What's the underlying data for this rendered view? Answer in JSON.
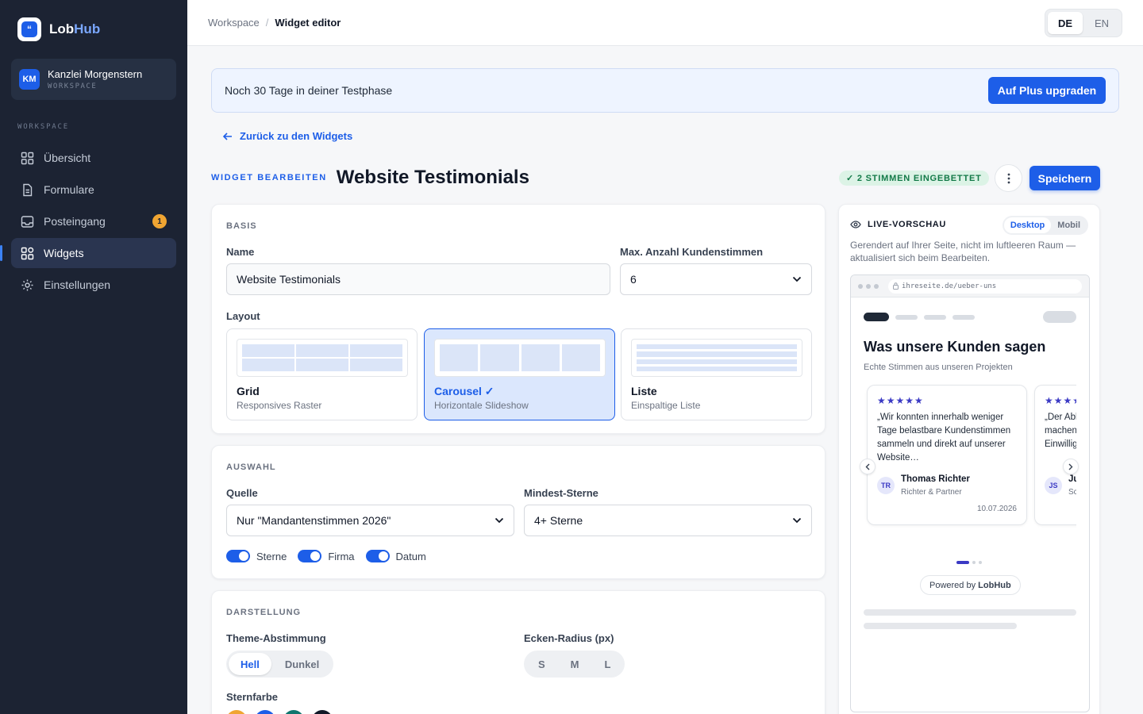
{
  "brand": {
    "name_a": "Lob",
    "name_b": "Hub",
    "logo_glyph": "“"
  },
  "workspace": {
    "initials": "KM",
    "name": "Kanzlei Morgenstern",
    "label": "WORKSPACE"
  },
  "sidebar": {
    "heading": "WORKSPACE",
    "items": [
      {
        "label": "Übersicht",
        "icon": "grid-icon"
      },
      {
        "label": "Formulare",
        "icon": "document-icon"
      },
      {
        "label": "Posteingang",
        "icon": "inbox-icon",
        "badge": "1"
      },
      {
        "label": "Widgets",
        "icon": "widgets-icon",
        "active": true
      },
      {
        "label": "Einstellungen",
        "icon": "gear-icon"
      }
    ]
  },
  "breadcrumb": {
    "root": "Workspace",
    "sep": "/",
    "current": "Widget editor"
  },
  "lang": {
    "de": "DE",
    "en": "EN",
    "active": "DE"
  },
  "trial": {
    "text": "Noch 30 Tage in deiner Testphase",
    "cta": "Auf Plus upgraden"
  },
  "back_link": "Zurück zu den Widgets",
  "header": {
    "kicker": "WIDGET BEARBEITEN",
    "title": "Website Testimonials",
    "embed_badge": "✓ 2 STIMMEN EINGEBETTET",
    "save": "Speichern"
  },
  "basis": {
    "section": "BASIS",
    "name_label": "Name",
    "name_value": "Website Testimonials",
    "max_label": "Max. Anzahl Kundenstimmen",
    "max_value": "6",
    "layout_label": "Layout",
    "layouts": [
      {
        "title": "Grid",
        "sub": "Responsives Raster"
      },
      {
        "title": "Carousel ✓",
        "sub": "Horizontale Slideshow"
      },
      {
        "title": "Liste",
        "sub": "Einspaltige Liste"
      }
    ]
  },
  "auswahl": {
    "section": "AUSWAHL",
    "source_label": "Quelle",
    "source_value": "Nur \"Mandantenstimmen 2026\"",
    "stars_label": "Mindest-Sterne",
    "stars_value": "4+ Sterne",
    "toggles": [
      {
        "label": "Sterne",
        "on": true
      },
      {
        "label": "Firma",
        "on": true
      },
      {
        "label": "Datum",
        "on": true
      }
    ]
  },
  "darstellung": {
    "section": "DARSTELLUNG",
    "theme_label": "Theme-Abstimmung",
    "theme_options": [
      "Hell",
      "Dunkel"
    ],
    "theme_active": "Hell",
    "radius_label": "Ecken-Radius (px)",
    "radius_options": [
      "S",
      "M",
      "L"
    ],
    "star_color_label": "Sternfarbe",
    "star_colors": [
      "#f0a532",
      "#1d5ee8",
      "#0f766e",
      "#111827"
    ]
  },
  "preview": {
    "title": "LIVE-VORSCHAU",
    "modes": [
      "Desktop",
      "Mobil"
    ],
    "mode_active": "Desktop",
    "note": "Gerendert auf Ihrer Seite, nicht im luftleeren Raum — aktualisiert sich beim Bearbeiten.",
    "url": "ihreseite.de/ueber-uns",
    "heading": "Was unsere Kunden sagen",
    "subheading": "Echte Stimmen aus unseren Projekten",
    "cards": [
      {
        "stars": "★★★★★",
        "quote": "„Wir konnten innerhalb weniger Tage belastbare Kundenstimmen sammeln und direkt auf unserer Website…",
        "initials": "TR",
        "name": "Thomas Richter",
        "role": "Richter & Partner",
        "date": "10.07.2026"
      },
      {
        "stars": "★★★★",
        "quote": "„Der Ablauf ist klar und Kunden machen gerne mit. Die Einwilligung ist nachvollziehbar…",
        "initials": "JS",
        "name": "Julia Schmidt",
        "role": "Schmidt Steuerberatung",
        "date": ""
      }
    ],
    "powered_prefix": "Powered by ",
    "powered_brand": "LobHub"
  }
}
